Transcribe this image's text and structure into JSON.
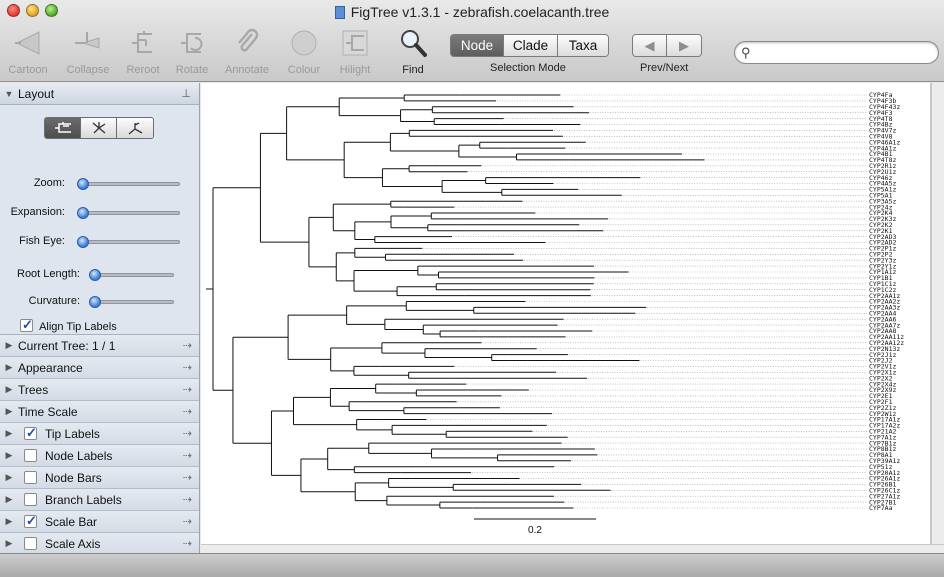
{
  "window": {
    "title": "FigTree v1.3.1 - zebrafish.coelacanth.tree"
  },
  "toolbar": {
    "cartoon": "Cartoon",
    "collapse": "Collapse",
    "reroot": "Reroot",
    "rotate": "Rotate",
    "annotate": "Annotate",
    "colour": "Colour",
    "hilight": "Hilight",
    "find": "Find",
    "selection_mode": {
      "node": "Node",
      "clade": "Clade",
      "taxa": "Taxa",
      "label": "Selection Mode",
      "selected": "Node"
    },
    "prev_next_label": "Prev/Next",
    "search": {
      "value": "",
      "placeholder": ""
    }
  },
  "sidebar": {
    "layout": {
      "title": "Layout",
      "sliders": [
        {
          "label": "Zoom:",
          "value": 0
        },
        {
          "label": "Expansion:",
          "value": 0
        },
        {
          "label": "Fish Eye:",
          "value": 0
        },
        {
          "label": "Root Length:",
          "value": 0
        },
        {
          "label": "Curvature:",
          "value": 0
        }
      ],
      "align_tip_labels": {
        "label": "Align Tip Labels",
        "checked": true
      }
    },
    "panels": [
      {
        "label": "Current Tree: 1 / 1"
      },
      {
        "label": "Appearance"
      },
      {
        "label": "Trees"
      },
      {
        "label": "Time Scale"
      }
    ],
    "options": [
      {
        "label": "Tip Labels",
        "checked": true
      },
      {
        "label": "Node Labels",
        "checked": false
      },
      {
        "label": "Node Bars",
        "checked": false
      },
      {
        "label": "Branch Labels",
        "checked": false
      },
      {
        "label": "Scale Bar",
        "checked": true
      },
      {
        "label": "Scale Axis",
        "checked": false
      }
    ]
  },
  "tree": {
    "scale_label": "0.2",
    "tips": [
      "CYP4Fa",
      "CYP4F3b",
      "CYP4F43z",
      "CYP4F3",
      "CYP4T8",
      "CYP4Bz",
      "CYP4V7z",
      "CYP4V8",
      "CYP46A1z",
      "CYP4A1z",
      "CYP4B1",
      "CYP4T8z",
      "CYP2R1z",
      "CYP2U1z",
      "CYP46z",
      "CYP4A5z",
      "CYP5A1z",
      "CYP5A1",
      "CYP3A5z",
      "CYP24z",
      "CYP2K4",
      "CYP2K3z",
      "CYP2K2",
      "CYP2K1",
      "CYP2AD3",
      "CYP2AD2",
      "CYP2P1z",
      "CYP2P2",
      "CYP2Y3z",
      "CYP2Y1z",
      "CYP1A1z",
      "CYP1B1",
      "CYP1C1z",
      "CYP1C2z",
      "CYP2AA1z",
      "CYP2AA2z",
      "CYP2AA3z",
      "CYP2AA4",
      "CYP2AA6",
      "CYP2AA7z",
      "CYP2AA8",
      "CYP2AA11z",
      "CYP2AA12z",
      "CYP2N13z",
      "CYP2J1z",
      "CYP2J2",
      "CYP2V1z",
      "CYP2X1z",
      "CYP2X2",
      "CYP2X4z",
      "CYP2X9z",
      "CYP2E1",
      "CYP2F1",
      "CYP2Z1z",
      "CYP2W1z",
      "CYP17A1z",
      "CYP17A2z",
      "CYP21A2",
      "CYP7A1z",
      "CYP7B1z",
      "CYP8B1z",
      "CYP8A1",
      "CYP39A1z",
      "CYP51z",
      "CYP20A1z",
      "CYP26A1z",
      "CYP26B1",
      "CYP26C1z",
      "CYP27A1z",
      "CYP27B1",
      "CYP7Aa"
    ]
  }
}
